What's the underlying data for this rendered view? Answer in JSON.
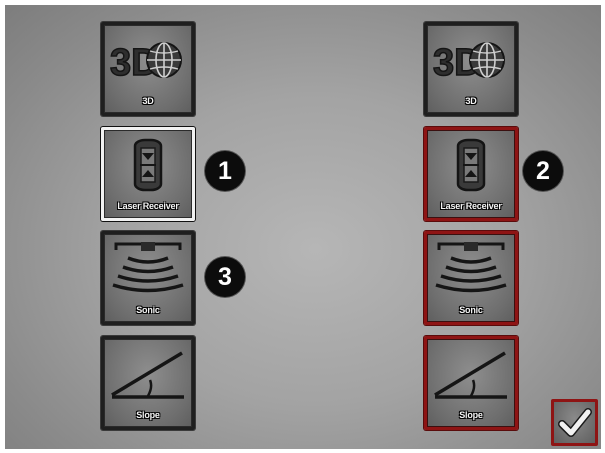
{
  "left_column": [
    {
      "id": "3d",
      "label": "3D",
      "icon": "3d-globe-icon",
      "state": "default"
    },
    {
      "id": "laser",
      "label": "Laser Receiver",
      "icon": "laser-receiver-icon",
      "state": "selected"
    },
    {
      "id": "sonic",
      "label": "Sonic",
      "icon": "sonic-icon",
      "state": "default"
    },
    {
      "id": "slope",
      "label": "Slope",
      "icon": "slope-icon",
      "state": "default"
    }
  ],
  "right_column": [
    {
      "id": "3d",
      "label": "3D",
      "icon": "3d-globe-icon",
      "state": "default"
    },
    {
      "id": "laser",
      "label": "Laser Receiver",
      "icon": "laser-receiver-icon",
      "state": "highlighted"
    },
    {
      "id": "sonic",
      "label": "Sonic",
      "icon": "sonic-icon",
      "state": "highlighted"
    },
    {
      "id": "slope",
      "label": "Slope",
      "icon": "slope-icon",
      "state": "highlighted"
    }
  ],
  "badges": [
    "1",
    "2",
    "3"
  ],
  "confirm": {
    "icon": "checkmark-icon"
  },
  "colors": {
    "highlight": "#8e1414",
    "selected": "#f2f2f2",
    "badge": "#0c0c0c"
  }
}
